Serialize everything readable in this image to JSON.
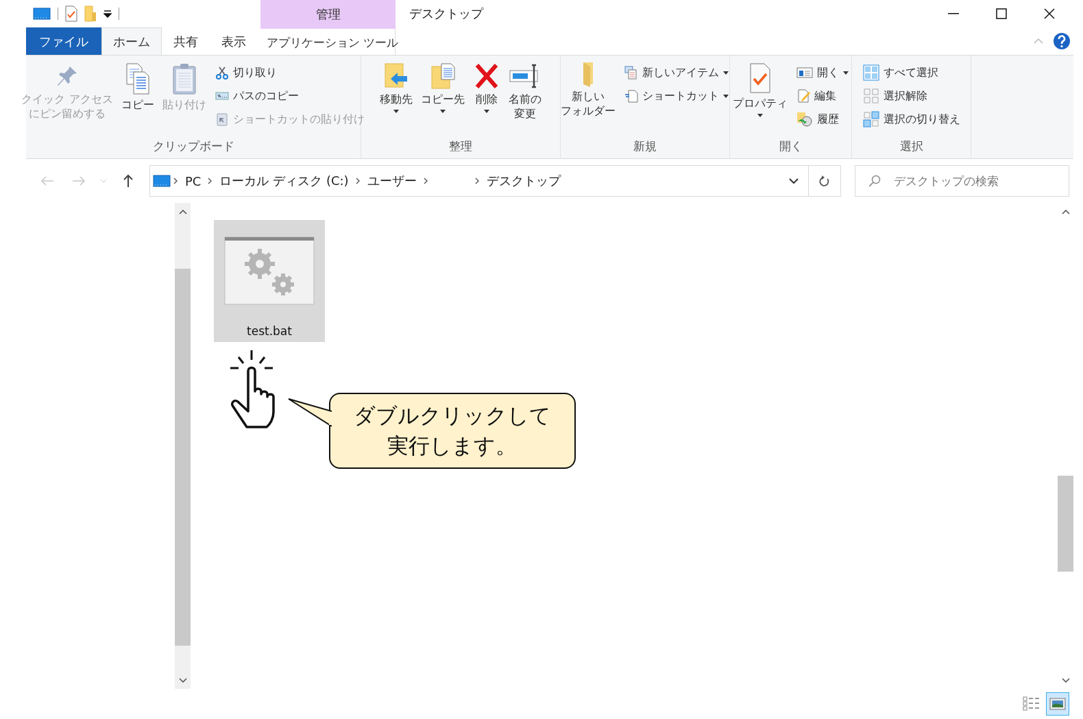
{
  "window": {
    "title": "デスクトップ"
  },
  "context_group": {
    "label": "管理"
  },
  "tabs": [
    {
      "label": "ファイル",
      "kind": "file",
      "selected": false
    },
    {
      "label": "ホーム",
      "kind": "tab",
      "selected": true
    },
    {
      "label": "共有",
      "kind": "tab",
      "selected": false
    },
    {
      "label": "表示",
      "kind": "tab",
      "selected": false
    },
    {
      "label": "アプリケーション ツール",
      "kind": "context",
      "selected": false
    }
  ],
  "ribbon": {
    "groups": [
      {
        "label": "クリップボード",
        "items": [
          {
            "lines": [
              "クイック アクセス",
              "にピン留めする"
            ],
            "kind": "large",
            "disabled": true,
            "dropdown": false
          },
          {
            "label": "コピー",
            "kind": "large",
            "disabled": false,
            "dropdown": false
          },
          {
            "label": "貼り付け",
            "kind": "large",
            "disabled": true,
            "dropdown": false
          },
          {
            "label": "切り取り",
            "kind": "small",
            "disabled": false,
            "dropdown": false
          },
          {
            "label": "パスのコピー",
            "kind": "small",
            "disabled": false,
            "dropdown": false
          },
          {
            "label": "ショートカットの貼り付け",
            "kind": "small",
            "disabled": true,
            "dropdown": false
          }
        ]
      },
      {
        "label": "整理",
        "items": [
          {
            "label": "移動先",
            "kind": "large",
            "disabled": false,
            "dropdown": true
          },
          {
            "label": "コピー先",
            "kind": "large",
            "disabled": false,
            "dropdown": true
          },
          {
            "label": "削除",
            "kind": "large",
            "disabled": false,
            "dropdown": true
          },
          {
            "lines": [
              "名前の",
              "変更"
            ],
            "kind": "large",
            "disabled": false,
            "dropdown": false
          }
        ]
      },
      {
        "label": "新規",
        "items": [
          {
            "lines": [
              "新しい",
              "フォルダー"
            ],
            "kind": "large",
            "disabled": false,
            "dropdown": false
          },
          {
            "label": "新しいアイテム",
            "kind": "small",
            "disabled": false,
            "dropdown": true
          },
          {
            "label": "ショートカット",
            "kind": "small",
            "disabled": false,
            "dropdown": true
          }
        ]
      },
      {
        "label": "開く",
        "items": [
          {
            "label": "プロパティ",
            "kind": "large",
            "disabled": false,
            "dropdown": true
          },
          {
            "label": "開く",
            "kind": "small",
            "disabled": false,
            "dropdown": true
          },
          {
            "label": "編集",
            "kind": "small",
            "disabled": false,
            "dropdown": false
          },
          {
            "label": "履歴",
            "kind": "small",
            "disabled": false,
            "dropdown": false
          }
        ]
      },
      {
        "label": "選択",
        "items": [
          {
            "label": "すべて選択",
            "kind": "small",
            "disabled": false,
            "dropdown": false
          },
          {
            "label": "選択解除",
            "kind": "small",
            "disabled": false,
            "dropdown": false
          },
          {
            "label": "選択の切り替え",
            "kind": "small",
            "disabled": false,
            "dropdown": false
          }
        ]
      }
    ]
  },
  "navigation": [
    {
      "kind": "back",
      "disabled": true
    },
    {
      "kind": "forward",
      "disabled": true
    },
    {
      "kind": "recent",
      "disabled": true
    },
    {
      "kind": "up",
      "disabled": false
    }
  ],
  "address_bar": {
    "path": [
      {
        "kind": "folder",
        "label": "PC"
      },
      {
        "kind": "folder",
        "label": "ローカル ディスク (C:)"
      },
      {
        "kind": "folder",
        "label": "ユーザー"
      },
      {
        "kind": "hidden"
      },
      {
        "kind": "folder",
        "label": "デスクトップ"
      }
    ]
  },
  "search": {
    "placeholder": "デスクトップの検索"
  },
  "files": [
    {
      "name": "test.bat",
      "selected": true
    }
  ],
  "callout": {
    "text": "ダブルクリックして実行します。"
  },
  "view_buttons": [
    {
      "kind": "details",
      "selected": false
    },
    {
      "kind": "large_icons",
      "selected": true
    }
  ]
}
